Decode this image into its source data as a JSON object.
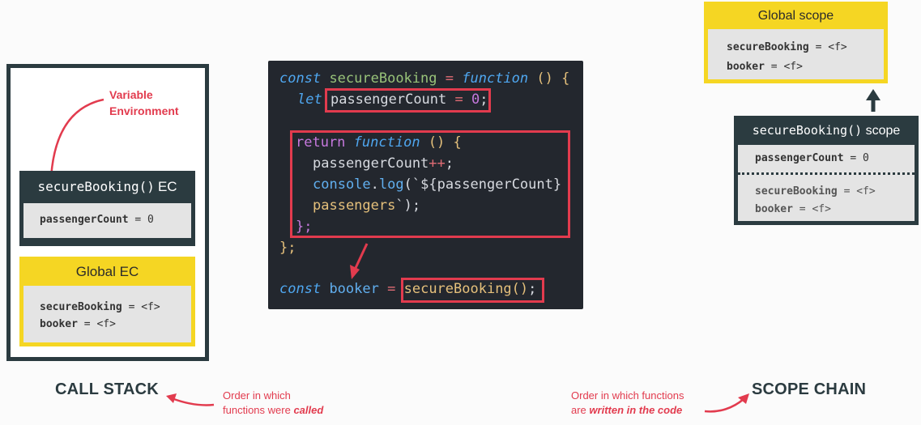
{
  "call_stack": {
    "annotation": "Variable Environment",
    "secure_ec": {
      "title_fn": "secureBooking()",
      "title_suffix": "EC",
      "var_name": "passengerCount",
      "var_value": "= 0"
    },
    "global_ec": {
      "title": "Global EC",
      "vars": [
        {
          "name": "secureBooking",
          "value": "= <f>"
        },
        {
          "name": "booker",
          "value": "= <f>"
        }
      ]
    },
    "label": "CALL STACK",
    "note_line1": "Order in which",
    "note_line2_prefix": "functions were ",
    "note_line2_em": "called"
  },
  "code": {
    "l1": {
      "kw": "const",
      "name": "secureBooking",
      "eq": "=",
      "fn_kw": "function",
      "tail": "() {"
    },
    "l2": {
      "kw": "let",
      "name": "passengerCount",
      "eq": "=",
      "num": "0",
      "semi": ";"
    },
    "l3": {
      "kw": "return",
      "fn_kw": "function",
      "tail": "() {"
    },
    "l4": {
      "name": "passengerCount",
      "op": "++",
      "semi": ";"
    },
    "l5": {
      "obj": "console",
      "dot": ".",
      "fn": "log",
      "open": "(`",
      "tpl": "${passengerCount}"
    },
    "l6": {
      "text": "passengers",
      "close": "`);"
    },
    "l7": {
      "text": "};"
    },
    "l8": {
      "text": "};"
    },
    "l9": {
      "kw": "const",
      "name": "booker",
      "eq": "=",
      "call": "secureBooking",
      "paren": "()",
      "semi": ";"
    }
  },
  "scope_chain": {
    "global": {
      "title": "Global scope",
      "vars": [
        {
          "name": "secureBooking",
          "value": "= <f>"
        },
        {
          "name": "booker",
          "value": "= <f>"
        }
      ]
    },
    "secure": {
      "title_fn": "secureBooking()",
      "title_suffix": "scope",
      "own_var": {
        "name": "passengerCount",
        "value": "= 0"
      },
      "inherited": [
        {
          "name": "secureBooking",
          "value": "= <f>"
        },
        {
          "name": "booker",
          "value": "= <f>"
        }
      ]
    },
    "label": "SCOPE CHAIN",
    "note_line1": "Order in which functions",
    "note_line2_prefix": "are ",
    "note_line2_em": "written in the code"
  },
  "colors": {
    "accent_red": "#e23b4e",
    "dark_box": "#2b3b40",
    "yellow_box": "#f5d623",
    "code_bg": "#23272e"
  }
}
